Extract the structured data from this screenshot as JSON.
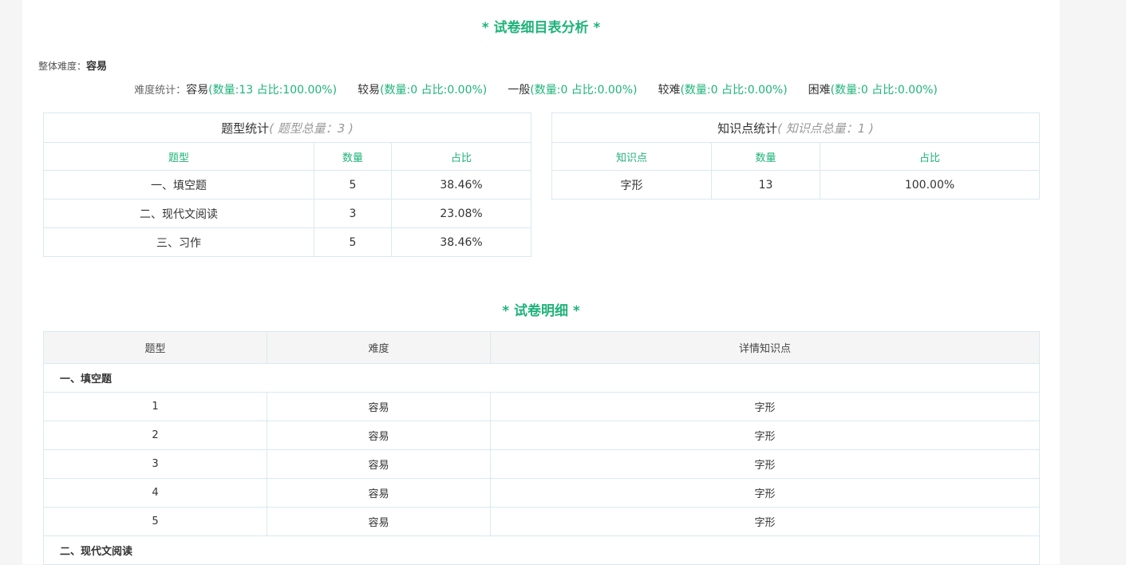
{
  "main_title": "* 试卷细目表分析 *",
  "overall": {
    "label": "整体难度：",
    "value": "容易"
  },
  "difficulty_stats": {
    "label": "难度统计：",
    "items": [
      {
        "name": "容易",
        "detail": "(数量:13   占比:100.00%)"
      },
      {
        "name": "较易",
        "detail": "(数量:0   占比:0.00%)"
      },
      {
        "name": "一般",
        "detail": "(数量:0   占比:0.00%)"
      },
      {
        "name": "较难",
        "detail": "(数量:0   占比:0.00%)"
      },
      {
        "name": "困难",
        "detail": "(数量:0   占比:0.00%)"
      }
    ]
  },
  "type_stats": {
    "title": "题型统计",
    "total": "( 题型总量：3 )",
    "headers": [
      "题型",
      "数量",
      "占比"
    ],
    "rows": [
      [
        "一、填空题",
        "5",
        "38.46%"
      ],
      [
        "二、现代文阅读",
        "3",
        "23.08%"
      ],
      [
        "三、习作",
        "5",
        "38.46%"
      ]
    ]
  },
  "knowledge_stats": {
    "title": "知识点统计",
    "total": "( 知识点总量：1 )",
    "headers": [
      "知识点",
      "数量",
      "占比"
    ],
    "rows": [
      [
        "字形",
        "13",
        "100.00%"
      ]
    ]
  },
  "detail_title": "* 试卷明细 *",
  "detail": {
    "headers": [
      "题型",
      "难度",
      "详情知识点"
    ],
    "sections": [
      {
        "name": "一、填空题",
        "rows": [
          [
            "1",
            "容易",
            "字形"
          ],
          [
            "2",
            "容易",
            "字形"
          ],
          [
            "3",
            "容易",
            "字形"
          ],
          [
            "4",
            "容易",
            "字形"
          ],
          [
            "5",
            "容易",
            "字形"
          ]
        ]
      },
      {
        "name": "二、现代文阅读",
        "rows": []
      }
    ]
  }
}
